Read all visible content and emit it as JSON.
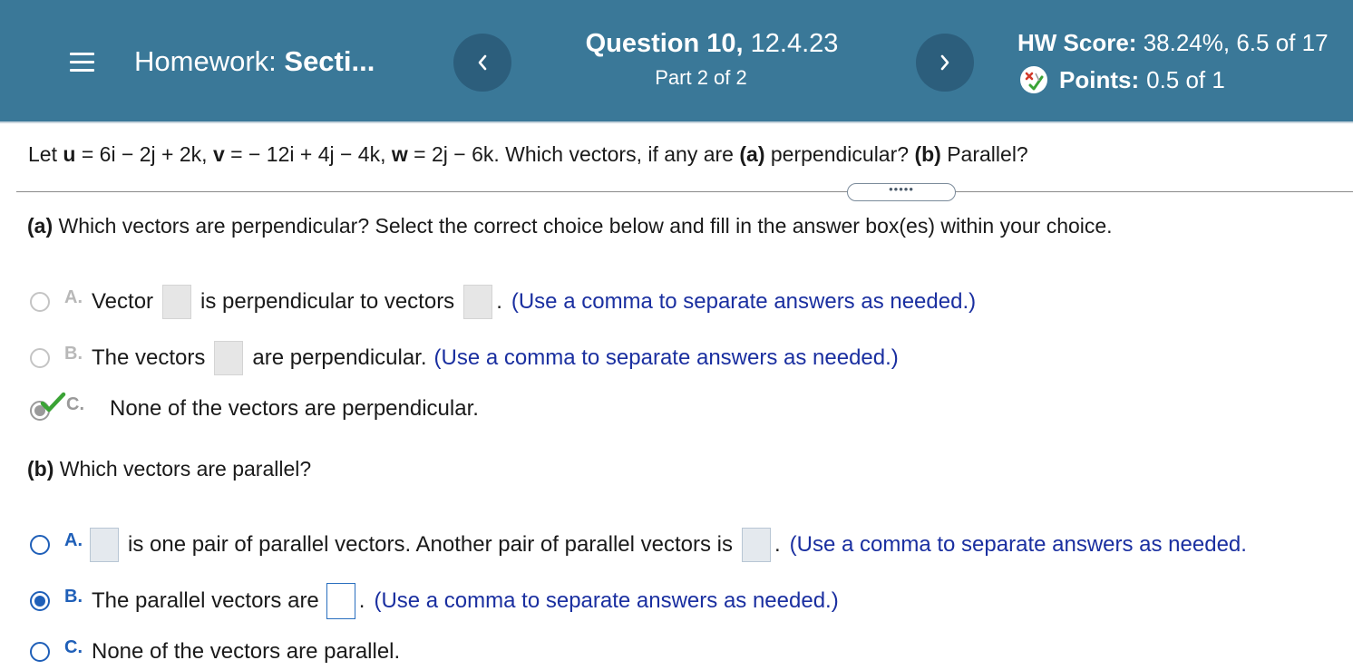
{
  "header": {
    "homework_label": "Homework:",
    "homework_section": "Secti...",
    "question_title_bold": "Question 10,",
    "question_code": "12.4.23",
    "part_text": "Part 2 of 2",
    "hw_score_label": "HW Score:",
    "hw_score_value": "38.24%, 6.5 of 17",
    "points_label": "Points:",
    "points_value": "0.5 of 1",
    "prev_icon": "chevron-left-icon",
    "next_icon": "chevron-right-icon",
    "menu_icon": "hamburger-icon",
    "points_icon": "partial-credit-icon"
  },
  "question": {
    "prompt": {
      "let": "Let ",
      "u_name": "u",
      "u_expr": " = 6i − 2j + 2k, ",
      "v_name": "v",
      "v_expr": " = − 12i + 4j − 4k, ",
      "w_name": "w",
      "w_expr": " = 2j − 6k. Which vectors, if any are ",
      "a_tag": "(a)",
      "a_text": " perpendicular? ",
      "b_tag": "(b)",
      "b_text": " Parallel?"
    },
    "expand_label": "•••••"
  },
  "part_a": {
    "tag": "(a)",
    "heading": " Which vectors are perpendicular? Select the correct choice below and fill in the answer box(es) within your choice.",
    "options": [
      {
        "letter": "A.",
        "t1": "Vector",
        "t2": "is perpendicular to vectors",
        "t3": ".",
        "hint": "(Use a comma to separate answers as needed.)"
      },
      {
        "letter": "B.",
        "t1": "The vectors",
        "t2": "are perpendicular.",
        "hint": "(Use a comma to separate answers as needed.)"
      },
      {
        "letter": "C.",
        "t1": "None of the vectors are perpendicular.",
        "state": "graded-correct"
      }
    ]
  },
  "part_b": {
    "tag": "(b)",
    "heading": " Which vectors are parallel?",
    "options": [
      {
        "letter": "A.",
        "t2": "is one pair of parallel vectors. Another pair of parallel vectors is",
        "t3": ".",
        "hint": "(Use a comma to separate answers as needed."
      },
      {
        "letter": "B.",
        "t1": "The parallel vectors are",
        "t3": ".",
        "hint": "(Use a comma to separate answers as needed.)",
        "state": "selected"
      },
      {
        "letter": "C.",
        "t1": "None of the vectors are parallel."
      }
    ]
  },
  "colors": {
    "header_bg": "#3a7898",
    "nav_button": "#2c5e7c",
    "accent_blue": "#1f5fb8",
    "hint_text": "#1a2fa0",
    "check_green": "#3aa335"
  }
}
